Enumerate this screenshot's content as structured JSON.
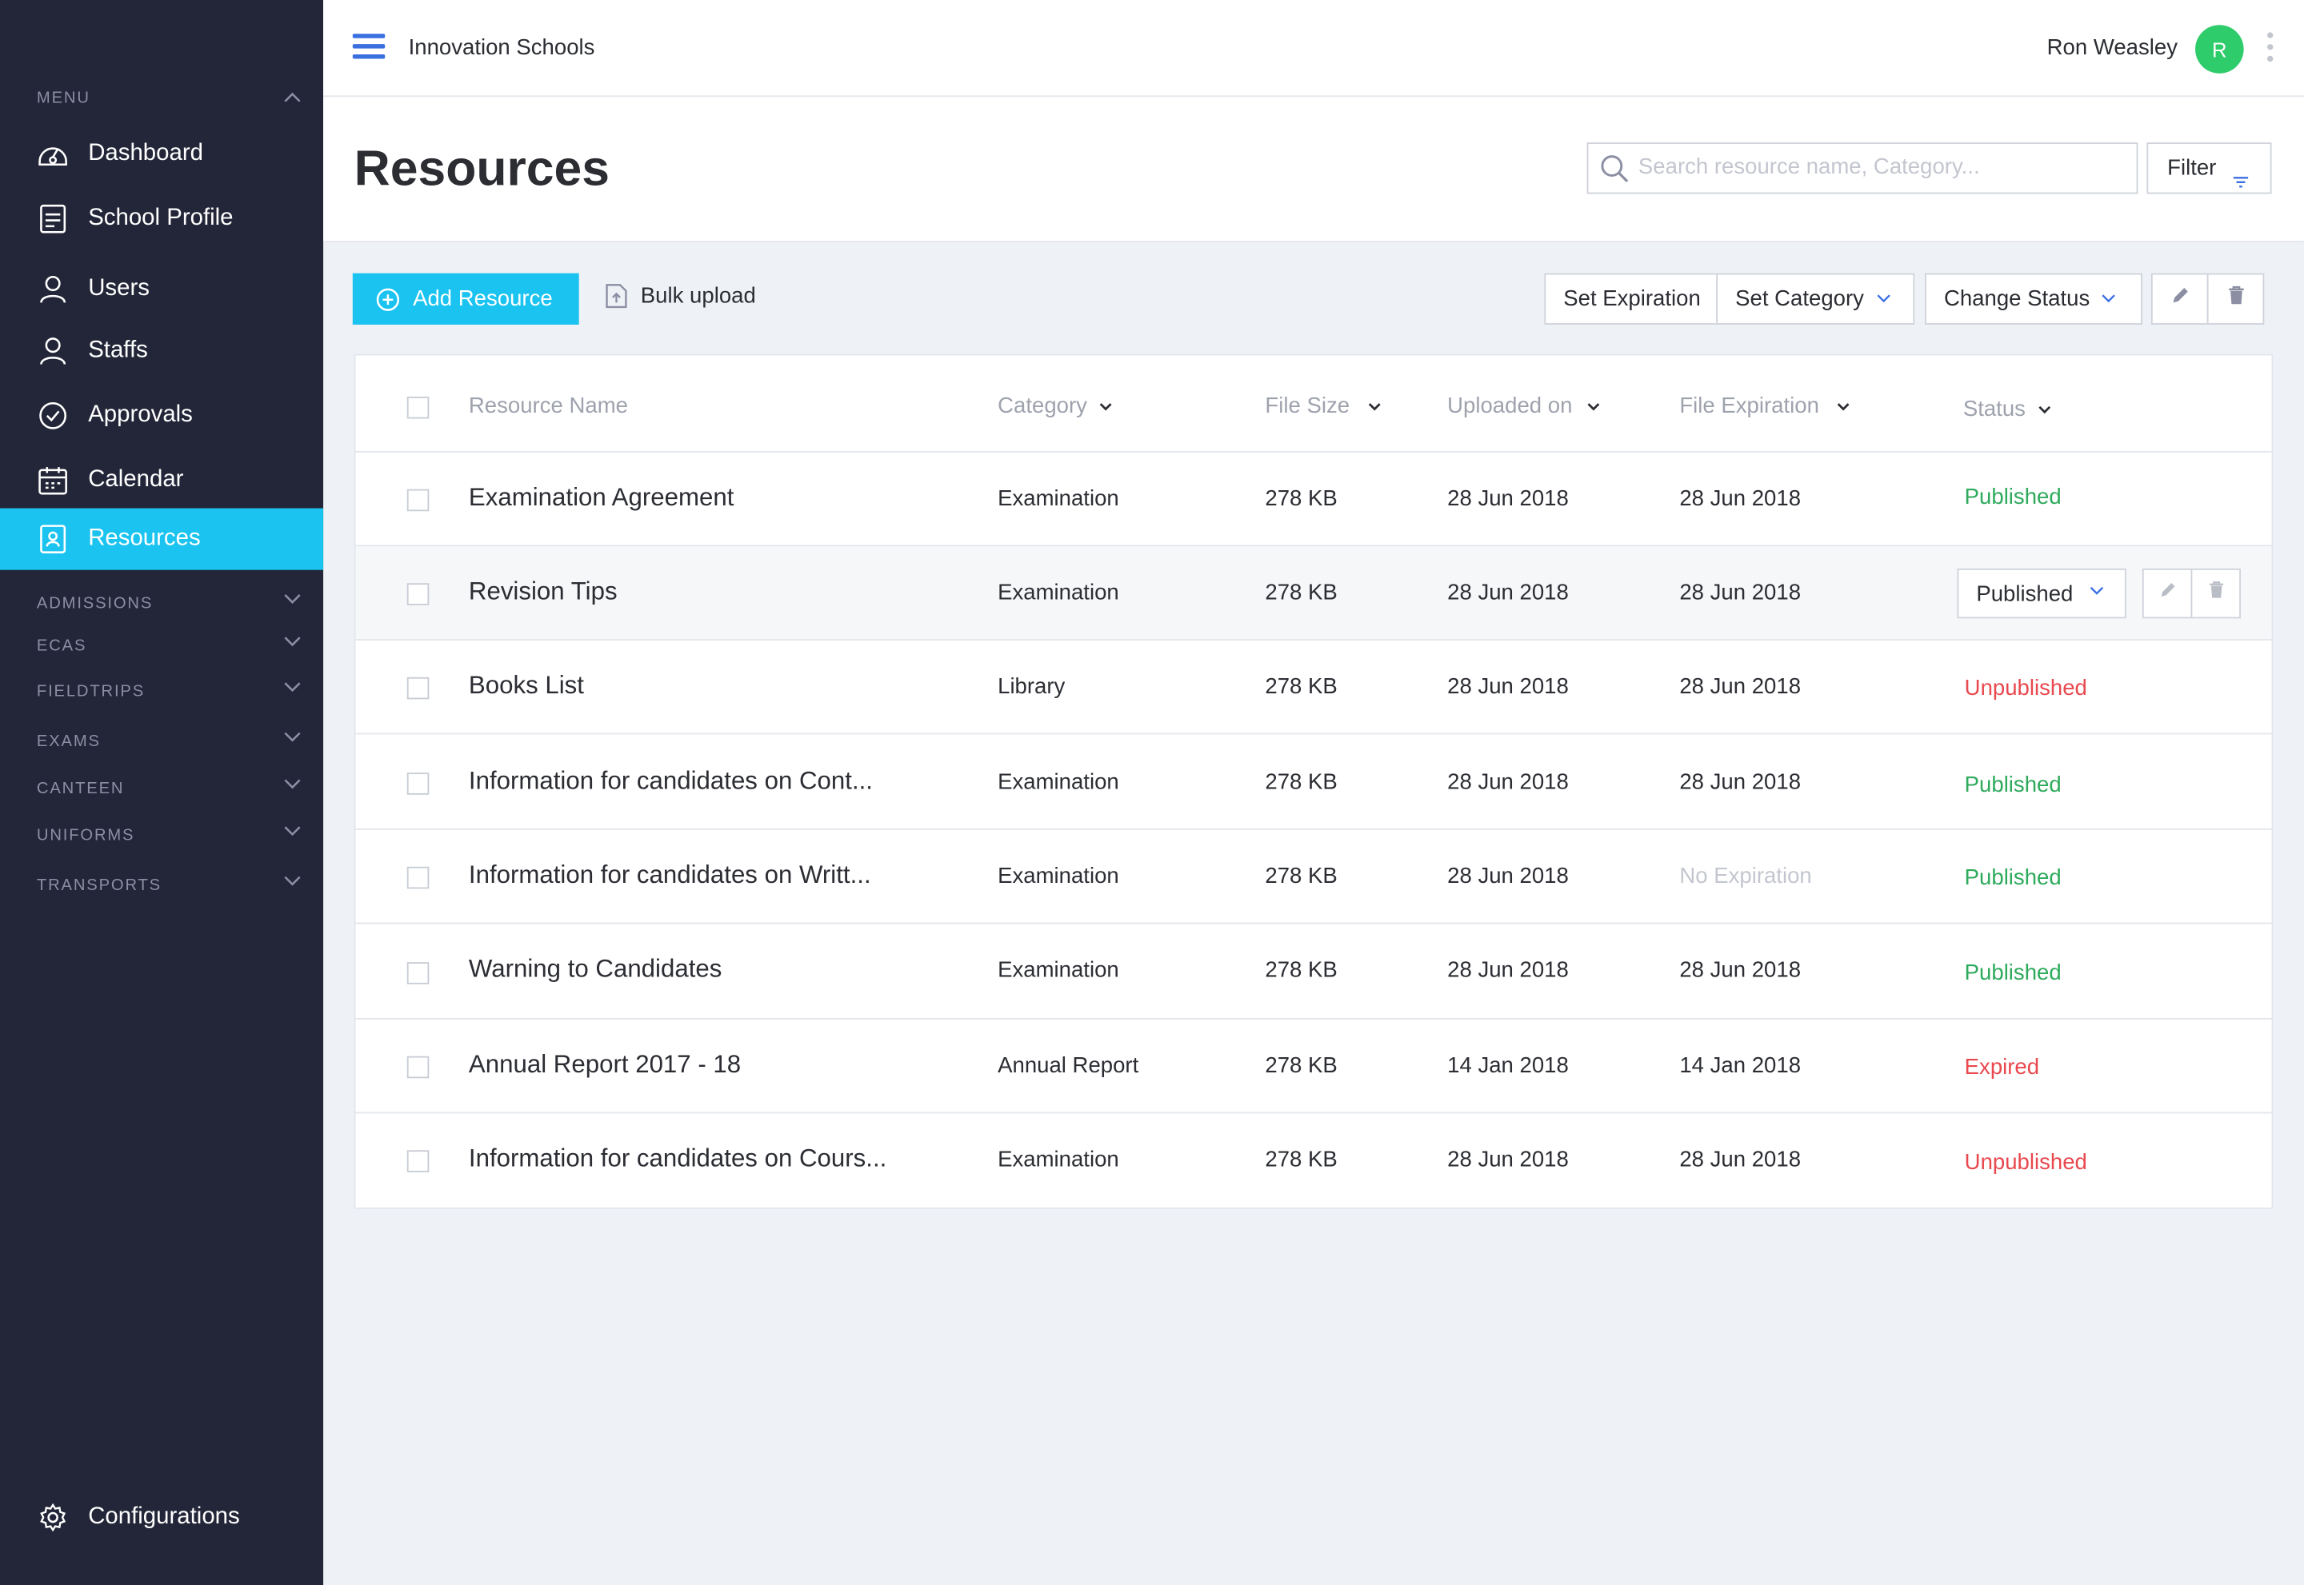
{
  "sidebar": {
    "menu_label": "MENU",
    "items": [
      {
        "label": "Dashboard",
        "icon": "dashboard-icon"
      },
      {
        "label": "School Profile",
        "icon": "school-profile-icon"
      },
      {
        "label": "Users",
        "icon": "user-icon"
      },
      {
        "label": "Staffs",
        "icon": "staff-icon"
      },
      {
        "label": "Approvals",
        "icon": "check-circle-icon"
      },
      {
        "label": "Calendar",
        "icon": "calendar-icon"
      },
      {
        "label": "Resources",
        "icon": "resources-icon",
        "active": true
      }
    ],
    "sections": [
      "ADMISSIONS",
      "ECAS",
      "FIELDTRIPS",
      "EXAMS",
      "CANTEEN",
      "UNIFORMS",
      "TRANSPORTS"
    ],
    "footer_label": "Configurations"
  },
  "topbar": {
    "org_name": "Innovation Schools",
    "user_name": "Ron Weasley",
    "avatar_initial": "R"
  },
  "header": {
    "title": "Resources",
    "search_placeholder": "Search resource name, Category...",
    "filter_label": "Filter"
  },
  "toolbar": {
    "add_label": "Add Resource",
    "bulk_label": "Bulk upload",
    "set_expiration": "Set Expiration",
    "set_category": "Set Category",
    "change_status": "Change Status"
  },
  "table": {
    "columns": [
      "Resource Name",
      "Category",
      "File Size",
      "Uploaded on",
      "File Expiration",
      "Status"
    ],
    "rows": [
      {
        "name": "Examination Agreement",
        "category": "Examination",
        "size": "278 KB",
        "uploaded": "28 Jun 2018",
        "expiration": "28 Jun 2018",
        "status": "Published"
      },
      {
        "name": "Revision Tips",
        "category": "Examination",
        "size": "278 KB",
        "uploaded": "28 Jun 2018",
        "expiration": "28 Jun 2018",
        "status": "Published"
      },
      {
        "name": "Books List",
        "category": "Library",
        "size": "278 KB",
        "uploaded": "28 Jun 2018",
        "expiration": "28 Jun 2018",
        "status": "Unpublished"
      },
      {
        "name": "Information for candidates on Cont...",
        "category": "Examination",
        "size": "278 KB",
        "uploaded": "28 Jun 2018",
        "expiration": "28 Jun 2018",
        "status": "Published"
      },
      {
        "name": "Information for candidates on Writt...",
        "category": "Examination",
        "size": "278 KB",
        "uploaded": "28 Jun 2018",
        "expiration": "No Expiration",
        "status": "Published"
      },
      {
        "name": "Warning to Candidates",
        "category": "Examination",
        "size": "278 KB",
        "uploaded": "28 Jun 2018",
        "expiration": "28 Jun 2018",
        "status": "Published"
      },
      {
        "name": "Annual Report 2017 - 18",
        "category": "Annual Report",
        "size": "278 KB",
        "uploaded": "14 Jan 2018",
        "expiration": "14 Jan 2018",
        "status": "Expired"
      },
      {
        "name": "Information for candidates on Cours...",
        "category": "Examination",
        "size": "278 KB",
        "uploaded": "28 Jun 2018",
        "expiration": "28 Jun 2018",
        "status": "Unpublished"
      }
    ]
  },
  "colors": {
    "sidebar_bg": "#232638",
    "accent": "#1ac3f0",
    "published": "#2eaa5c",
    "unpublished": "#e8484e",
    "avatar": "#2ecc6a"
  }
}
